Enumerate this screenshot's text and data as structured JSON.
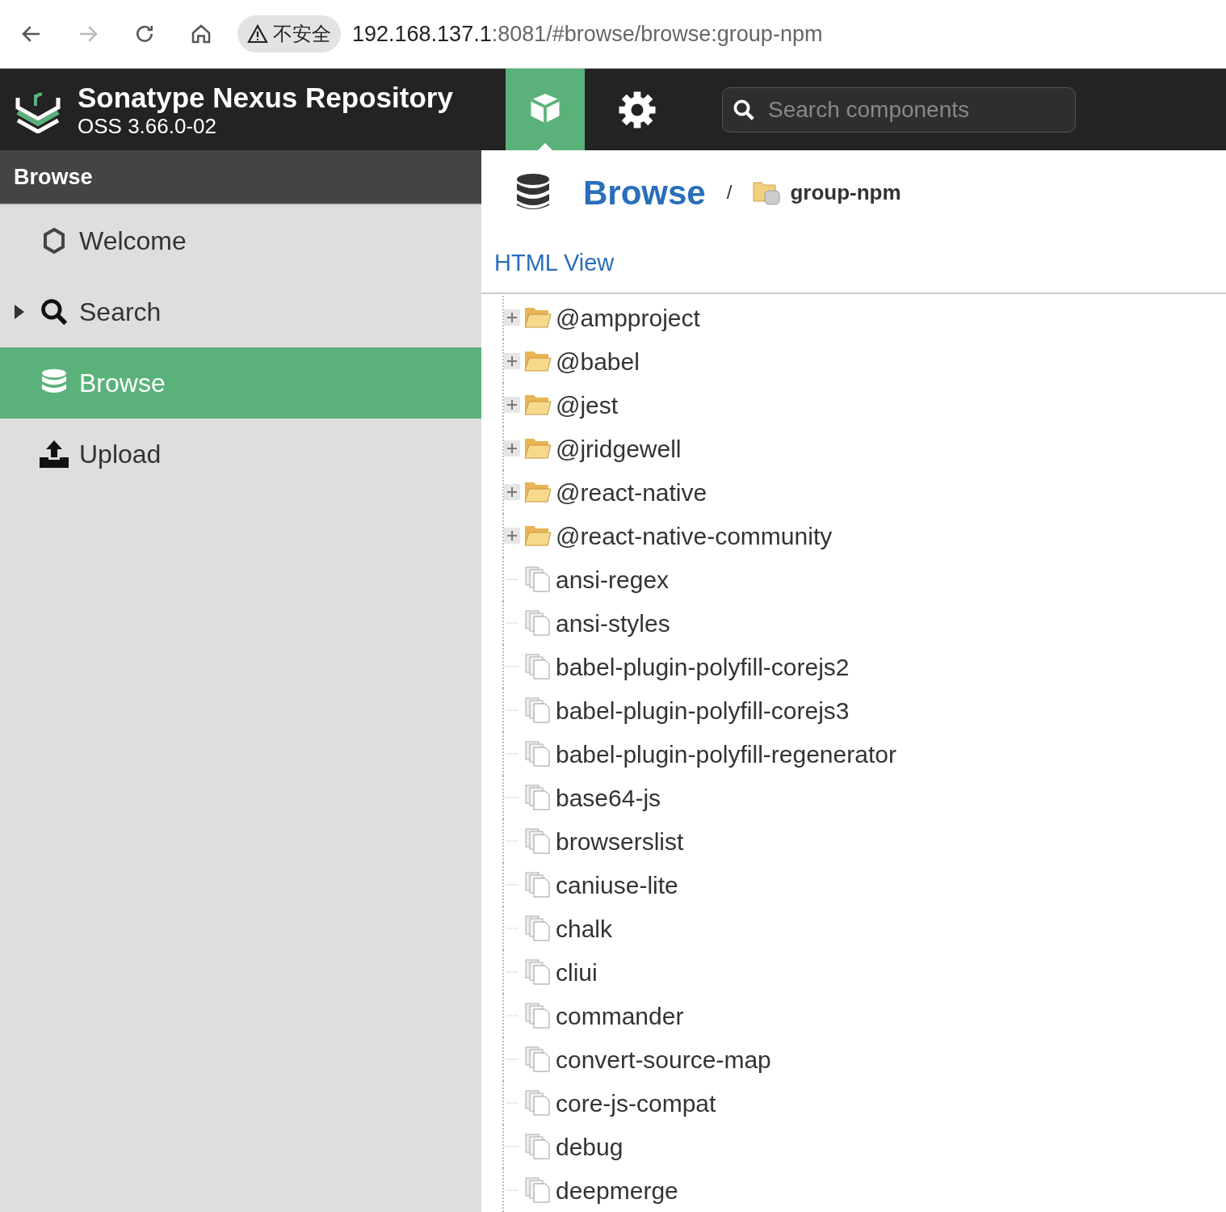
{
  "browser": {
    "security_label": "不安全",
    "url_host": "192.168.137.1",
    "url_rest": ":8081/#browse/browse:group-npm"
  },
  "header": {
    "title": "Sonatype Nexus Repository",
    "version": "OSS 3.66.0-02",
    "modes": [
      {
        "kind": "browse",
        "selected": true
      },
      {
        "kind": "admin",
        "selected": false
      }
    ],
    "search": {
      "placeholder": "Search components"
    }
  },
  "sidebar": {
    "title": "Browse",
    "items": [
      {
        "label": "Welcome",
        "kind": "welcome",
        "selected": false,
        "expandable": false
      },
      {
        "label": "Search",
        "kind": "search",
        "selected": false,
        "expandable": true
      },
      {
        "label": "Browse",
        "kind": "browse",
        "selected": true,
        "expandable": false
      },
      {
        "label": "Upload",
        "kind": "upload",
        "selected": false,
        "expandable": false
      }
    ]
  },
  "content": {
    "breadcrumb": {
      "section": "Browse",
      "separator": "/",
      "repository": "group-npm"
    },
    "html_view_link": "HTML View",
    "tree": [
      {
        "label": "@ampproject",
        "kind": "folder",
        "expanded": false
      },
      {
        "label": "@babel",
        "kind": "folder",
        "expanded": false
      },
      {
        "label": "@jest",
        "kind": "folder",
        "expanded": false
      },
      {
        "label": "@jridgewell",
        "kind": "folder",
        "expanded": false
      },
      {
        "label": "@react-native",
        "kind": "folder",
        "expanded": false
      },
      {
        "label": "@react-native-community",
        "kind": "folder",
        "expanded": false
      },
      {
        "label": "ansi-regex",
        "kind": "file"
      },
      {
        "label": "ansi-styles",
        "kind": "file"
      },
      {
        "label": "babel-plugin-polyfill-corejs2",
        "kind": "file"
      },
      {
        "label": "babel-plugin-polyfill-corejs3",
        "kind": "file"
      },
      {
        "label": "babel-plugin-polyfill-regenerator",
        "kind": "file"
      },
      {
        "label": "base64-js",
        "kind": "file"
      },
      {
        "label": "browserslist",
        "kind": "file"
      },
      {
        "label": "caniuse-lite",
        "kind": "file"
      },
      {
        "label": "chalk",
        "kind": "file"
      },
      {
        "label": "cliui",
        "kind": "file"
      },
      {
        "label": "commander",
        "kind": "file"
      },
      {
        "label": "convert-source-map",
        "kind": "file"
      },
      {
        "label": "core-js-compat",
        "kind": "file"
      },
      {
        "label": "debug",
        "kind": "file"
      },
      {
        "label": "deepmerge",
        "kind": "file"
      }
    ]
  }
}
